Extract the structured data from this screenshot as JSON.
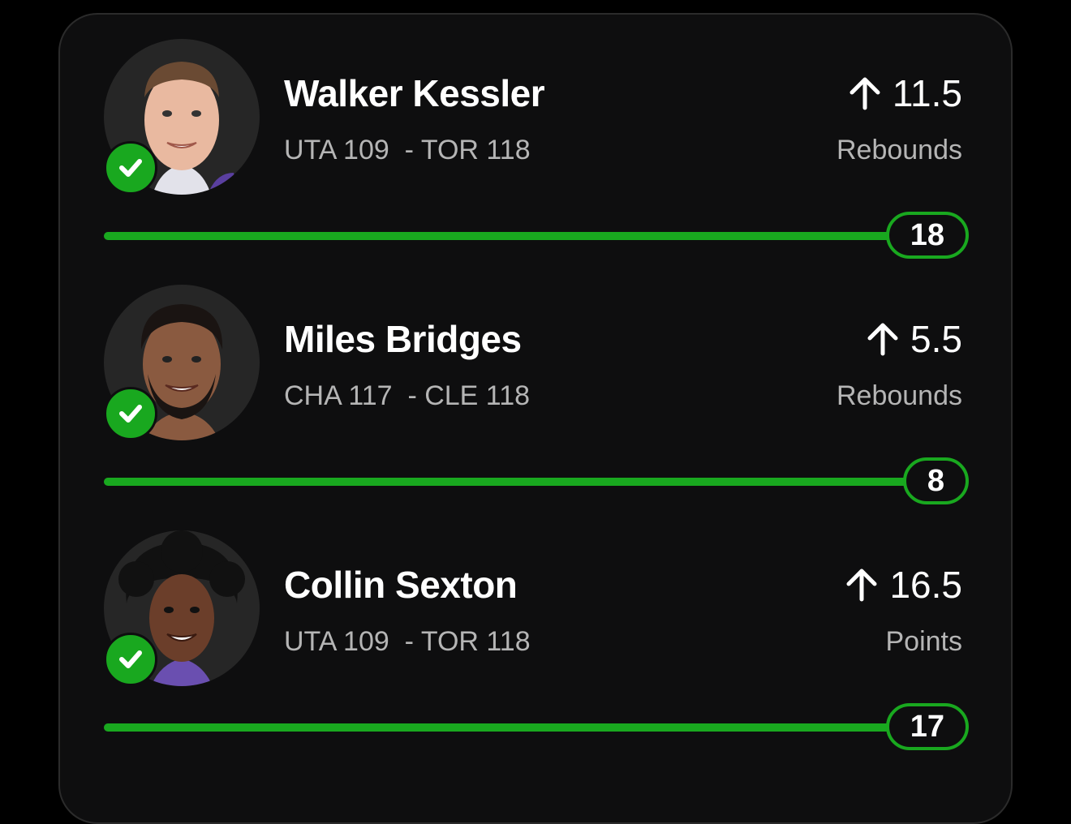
{
  "colors": {
    "background": "#000000",
    "card": "#0e0e0f",
    "accent_green": "#19a81f",
    "text_primary": "#ffffff",
    "text_secondary": "#b5b5b5"
  },
  "picks": [
    {
      "player": "Walker Kessler",
      "matchup": "UTA 109  - TOR 118",
      "direction_icon": "arrow-up-icon",
      "line": "11.5",
      "stat_type": "Rebounds",
      "result": "18",
      "status_icon": "checkmark-icon",
      "progress": 1.0
    },
    {
      "player": "Miles Bridges",
      "matchup": "CHA 117  - CLE 118",
      "direction_icon": "arrow-up-icon",
      "line": "5.5",
      "stat_type": "Rebounds",
      "result": "8",
      "status_icon": "checkmark-icon",
      "progress": 1.0
    },
    {
      "player": "Collin Sexton",
      "matchup": "UTA 109  - TOR 118",
      "direction_icon": "arrow-up-icon",
      "line": "16.5",
      "stat_type": "Points",
      "result": "17",
      "status_icon": "checkmark-icon",
      "progress": 1.0
    }
  ]
}
